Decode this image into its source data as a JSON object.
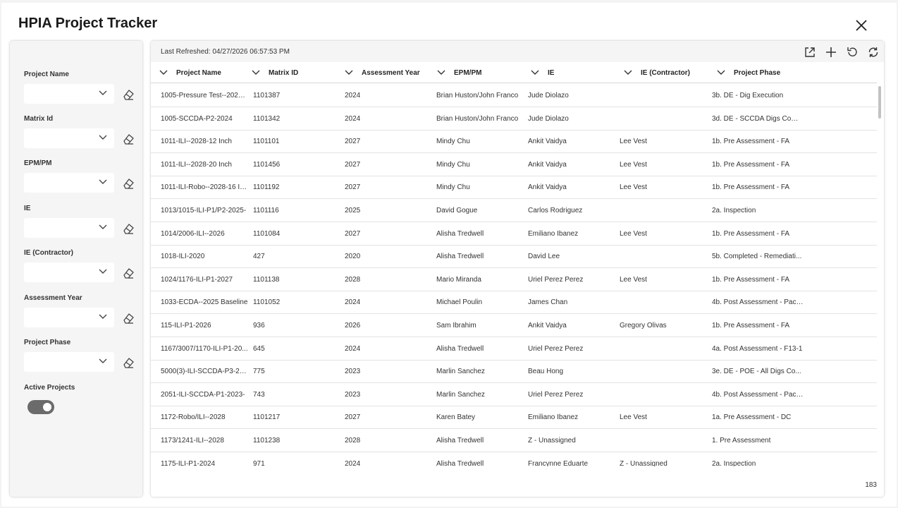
{
  "app": {
    "title": "HPIA Project Tracker"
  },
  "filters": [
    {
      "label": "Project Name"
    },
    {
      "label": "Matrix Id"
    },
    {
      "label": "EPM/PM"
    },
    {
      "label": "IE"
    },
    {
      "label": "IE (Contractor)"
    },
    {
      "label": "Assessment Year"
    },
    {
      "label": "Project Phase"
    }
  ],
  "active_projects": {
    "label": "Active Projects",
    "on": true
  },
  "toolbar": {
    "last_refreshed": "Last Refreshed: 04/27/2026 06:57:53 PM",
    "icons": [
      "open-external-icon",
      "add-icon",
      "undo-icon",
      "refresh-icon"
    ]
  },
  "columns": [
    "Project Name",
    "Matrix ID",
    "Assessment Year",
    "EPM/PM",
    "IE",
    "IE (Contractor)",
    "Project Phase"
  ],
  "rows": [
    [
      "1005-Pressure Test--2025-...",
      "1101387",
      "2024",
      "Brian Huston/John Franco",
      "Jude Diolazo",
      "",
      "3b. DE - Dig Execution"
    ],
    [
      "1005-SCCDA-P2-2024",
      "1101342",
      "2024",
      "Brian Huston/John Franco",
      "Jude Diolazo",
      "",
      "3d. DE - SCCDA Digs Comp..."
    ],
    [
      "1011-ILI--2028-12 Inch",
      "1101101",
      "2027",
      "Mindy Chu",
      "Ankit Vaidya",
      "Lee Vest",
      "1b. Pre Assessment - FA"
    ],
    [
      "1011-ILI--2028-20 Inch",
      "1101456",
      "2027",
      "Mindy Chu",
      "Ankit Vaidya",
      "Lee Vest",
      "1b. Pre Assessment - FA"
    ],
    [
      "1011-ILI-Robo--2028-16 In...",
      "1101192",
      "2027",
      "Mindy Chu",
      "Ankit Vaidya",
      "Lee Vest",
      "1b. Pre Assessment - FA"
    ],
    [
      "1013/1015-ILI-P1/P2-2025-",
      "1101116",
      "2025",
      "David Gogue",
      "Carlos Rodriguez",
      "",
      "2a. Inspection"
    ],
    [
      "1014/2006-ILI--2026",
      "1101084",
      "2027",
      "Alisha Tredwell",
      "Emiliano Ibanez",
      "Lee Vest",
      "1b. Pre Assessment - FA"
    ],
    [
      "1018-ILI-2020",
      "427",
      "2020",
      "Alisha Tredwell",
      "David Lee",
      "",
      "5b. Completed - Remediati..."
    ],
    [
      "1024/1176-ILI-P1-2027",
      "1101138",
      "2028",
      "Mario Miranda",
      "Uriel Perez Perez",
      "Lee Vest",
      "1b. Pre Assessment - FA"
    ],
    [
      "1033-ECDA--2025 Baseline",
      "1101052",
      "2024",
      "Michael Poulin",
      "James Chan",
      "",
      "4b. Post Assessment - Pack..."
    ],
    [
      "115-ILI-P1-2026",
      "936",
      "2026",
      "Sam Ibrahim",
      "Ankit Vaidya",
      "Gregory Olivas",
      "1b. Pre Assessment - FA"
    ],
    [
      "1167/3007/1170-ILI-P1-20...",
      "645",
      "2024",
      "Alisha Tredwell",
      "Uriel Perez Perez",
      "",
      "4a. Post Assessment - F13-1"
    ],
    [
      "5000(3)-ILI-SCCDA-P3-2025-",
      "775",
      "2023",
      "Marlin Sanchez",
      "Beau Hong",
      "",
      "3e. DE - POE - All Digs Co..."
    ],
    [
      "2051-ILI-SCCDA-P1-2023-",
      "743",
      "2023",
      "Marlin Sanchez",
      "Uriel Perez Perez",
      "",
      "4b. Post Assessment - Pack..."
    ],
    [
      "1172-Robo/ILI--2028",
      "1101217",
      "2027",
      "Karen Batey",
      "Emiliano Ibanez",
      "Lee Vest",
      "1a. Pre Assessment - DC"
    ],
    [
      "1173/1241-ILI--2028",
      "1101238",
      "2028",
      "Alisha Tredwell",
      "Z - Unassigned",
      "",
      "1. Pre Assessment"
    ],
    [
      "1175-ILI-P1-2024",
      "971",
      "2024",
      "Alisha Tredwell",
      "Francynne Eduarte",
      "Z - Unassigned",
      "2a. Inspection"
    ]
  ],
  "record_count": "183"
}
